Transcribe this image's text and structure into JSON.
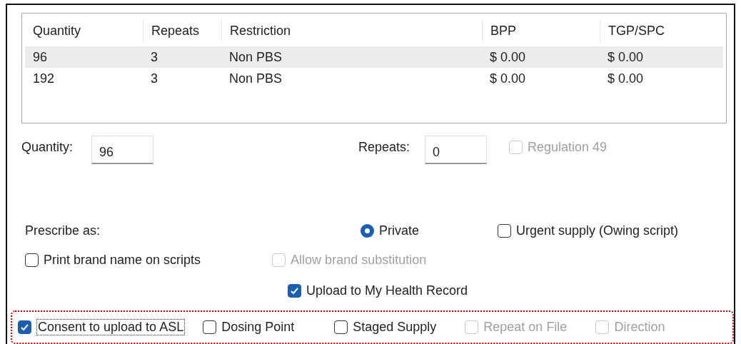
{
  "table": {
    "columns": [
      "Quantity",
      "Repeats",
      "Restriction",
      "BPP",
      "TGP/SPC"
    ],
    "rows": [
      {
        "cells": [
          "96",
          "3",
          "Non PBS",
          "$ 0.00",
          "$ 0.00"
        ],
        "selected": true
      },
      {
        "cells": [
          "192",
          "3",
          "Non PBS",
          "$ 0.00",
          "$ 0.00"
        ],
        "selected": false
      }
    ]
  },
  "quantity": {
    "label": "Quantity:",
    "value": "96"
  },
  "repeats": {
    "label": "Repeats:",
    "value": "0"
  },
  "regulation_49": {
    "label": "Regulation 49",
    "checked": false,
    "disabled": true
  },
  "prescribe_label": "Prescribe as:",
  "private": {
    "label": "Private",
    "selected": true
  },
  "urgent_supply": {
    "label": "Urgent supply (Owing script)",
    "checked": false,
    "disabled": false
  },
  "print_brand": {
    "label": "Print brand name on scripts",
    "checked": false,
    "disabled": false
  },
  "allow_brand": {
    "label": "Allow brand substitution",
    "checked": false,
    "disabled": true
  },
  "upload_mhr": {
    "label": "Upload to My Health Record",
    "checked": true,
    "disabled": false
  },
  "highlighted_options": [
    {
      "label": "Consent to upload to ASL",
      "checked": true,
      "disabled": false
    },
    {
      "label": "Dosing Point",
      "checked": false,
      "disabled": false
    },
    {
      "label": "Staged Supply",
      "checked": false,
      "disabled": false
    },
    {
      "label": "Repeat on File",
      "checked": false,
      "disabled": true
    },
    {
      "label": "Direction",
      "checked": false,
      "disabled": true
    }
  ]
}
